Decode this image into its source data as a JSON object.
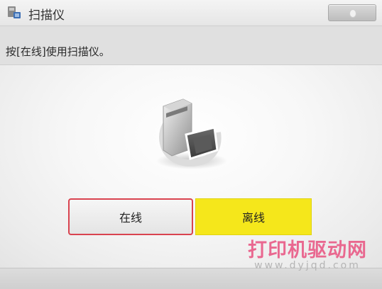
{
  "titlebar": {
    "icon": "scanner-icon",
    "title": "扫描仪"
  },
  "instruction": {
    "text": "按[在线]使用扫描仪。"
  },
  "content": {
    "graphic": "scanner-illustration"
  },
  "buttons": {
    "online_label": "在线",
    "offline_label": "离线",
    "online_border_color": "#d9434f",
    "offline_color": "#f5e71b"
  },
  "watermark": {
    "title": "打印机驱动网",
    "url": "www.dyjqd.com"
  }
}
